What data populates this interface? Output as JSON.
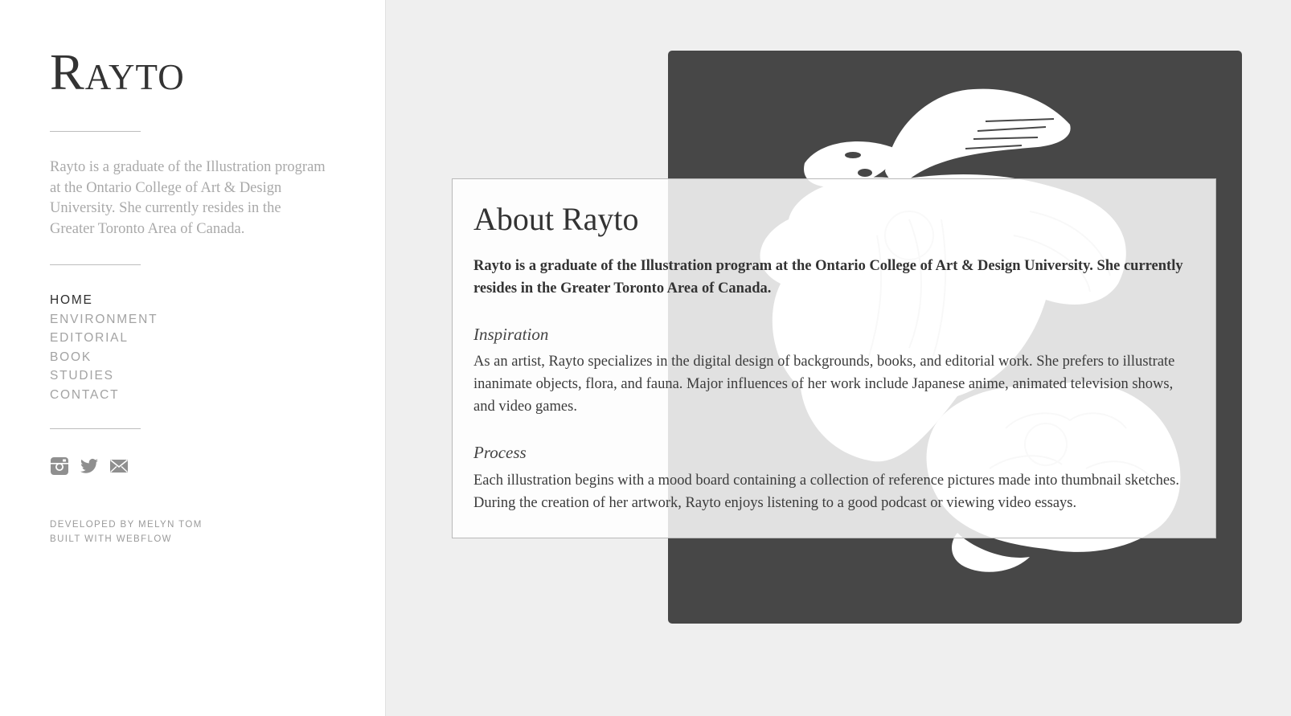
{
  "brand": {
    "name": "Rayto"
  },
  "sidebar": {
    "intro": "Rayto is a graduate of the Illustration program at the Ontario College of Art & Design University. She currently resides in the Greater Toronto Area of Canada.",
    "nav": [
      {
        "label": "HOME",
        "active": true
      },
      {
        "label": "ENVIRONMENT",
        "active": false
      },
      {
        "label": "EDITORIAL",
        "active": false
      },
      {
        "label": "BOOK",
        "active": false
      },
      {
        "label": "STUDIES",
        "active": false
      },
      {
        "label": "CONTACT",
        "active": false
      }
    ],
    "social": [
      "instagram-icon",
      "twitter-icon",
      "mail-icon"
    ],
    "credits": {
      "developed_by": "DEVELOPED BY MELYN TOM",
      "built_with": "BUILT WITH WEBFLOW"
    }
  },
  "about": {
    "title": "About Rayto",
    "lead": "Rayto is a graduate of the Illustration program at the Ontario College of Art & Design University. She currently resides in the Greater Toronto Area of Canada.",
    "sections": [
      {
        "heading": "Inspiration",
        "body": "As an artist, Rayto specializes in the digital design of backgrounds, books, and editorial work. She prefers to illustrate inanimate objects, flora, and fauna. Major influences of her work include Japanese anime, animated television shows, and video games."
      },
      {
        "heading": "Process",
        "body": "Each illustration begins with a mood board containing a collection of reference pictures made into thumbnail sketches. During the creation of her artwork, Rayto enjoys listening to a good podcast or viewing video essays."
      }
    ]
  },
  "colors": {
    "sidebar_bg": "#ffffff",
    "page_bg": "#efefef",
    "hero_bg": "#474747",
    "nav_active": "#2e2e2e",
    "nav_inactive": "#a3a3a3"
  }
}
